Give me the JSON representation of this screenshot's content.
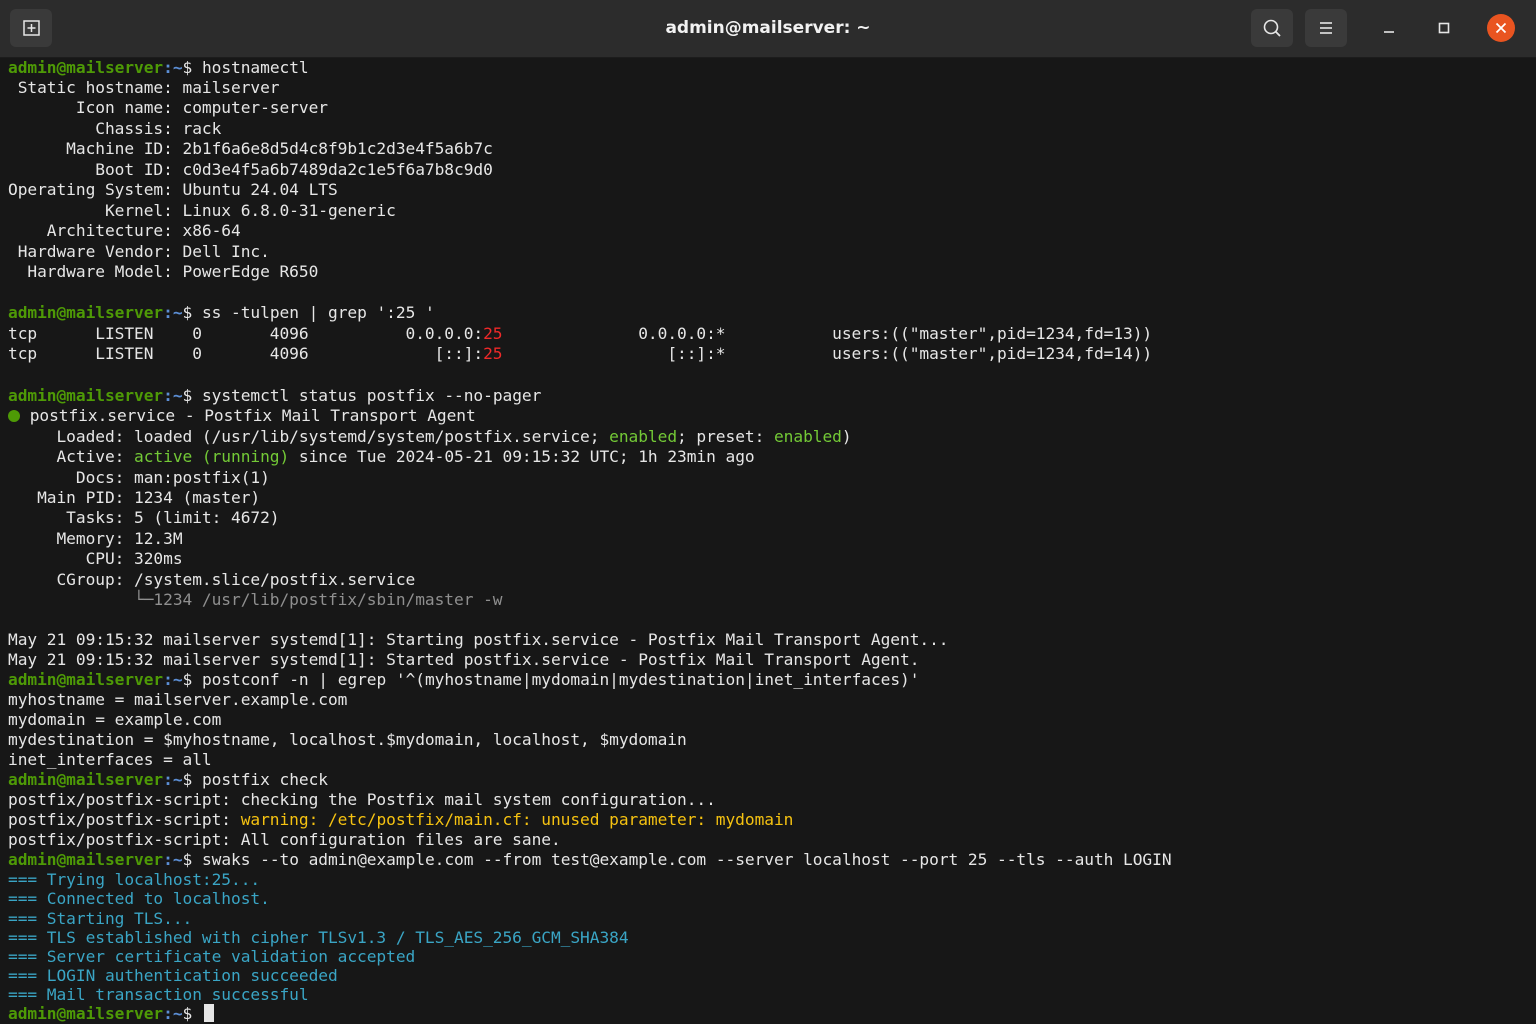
{
  "window": {
    "title": "admin@mailserver: ~",
    "icons": {
      "new_tab": "new-tab-icon",
      "search": "search-icon",
      "menu": "hamburger-menu-icon",
      "minimize": "minimize-icon",
      "maximize": "maximize-icon",
      "close": "close-icon"
    },
    "colors": {
      "close_button": "#e95420",
      "background": "#171717",
      "titlebar": "#2c2c2c"
    }
  },
  "prompt": {
    "user_host": "admin@mailserver",
    "path": ":~",
    "symbol": "$ "
  },
  "colors": {
    "prompt_user": "#4e9a06",
    "prompt_path": "#5c8fd6",
    "port_highlight": "#ef2929",
    "enabled_green": "#73c936",
    "warning_yellow": "#f5c211",
    "swaks_cyan": "#3aa5c5"
  },
  "commands": {
    "hostnamectl": "hostnamectl",
    "ss": "ss -tulpen | grep ':25 '",
    "systemctl": "systemctl status postfix --no-pager",
    "postconf": "postconf -n | egrep '^(myhostname|mydomain|mydestination|inet_interfaces)'",
    "postfix_check": "postfix check",
    "swaks": "swaks --to admin@example.com --from test@example.com --server localhost --port 25 --tls --auth LOGIN"
  },
  "hostnamectl": [
    " Static hostname: mailserver",
    "       Icon name: computer-server",
    "         Chassis: rack",
    "      Machine ID: 2b1f6a6e8d5d4c8f9b1c2d3e4f5a6b7c",
    "         Boot ID: c0d3e4f5a6b7489da2c1e5f6a7b8c9d0",
    "Operating System: Ubuntu 24.04 LTS",
    "          Kernel: Linux 6.8.0-31-generic",
    "    Architecture: x86-64",
    " Hardware Vendor: Dell Inc.",
    "  Hardware Model: PowerEdge R650"
  ],
  "ss_rows": [
    {
      "pre": "tcp      LISTEN    0       4096          0.0.0.0:",
      "port": "25",
      "post": "              0.0.0.0:*           users:((\"master\",pid=1234,fd=13))"
    },
    {
      "pre": "tcp      LISTEN    0       4096             [::]:",
      "port": "25",
      "post": "                 [::]:*           users:((\"master\",pid=1234,fd=14))"
    }
  ],
  "systemctl": {
    "unit_line": " postfix.service - Postfix Mail Transport Agent",
    "loaded_pre": "     Loaded: loaded (/usr/lib/systemd/system/postfix.service; ",
    "loaded_enabled": "enabled",
    "loaded_mid": "; preset: ",
    "loaded_preset": "enabled",
    "loaded_end": ")",
    "active_label": "     Active: ",
    "active_state": "active (running)",
    "active_rest": " since Tue 2024-05-21 09:15:32 UTC; 1h 23min ago",
    "docs": "       Docs: man:postfix(1)",
    "main_pid": "   Main PID: 1234 (master)",
    "tasks": "      Tasks: 5 (limit: 4672)",
    "memory": "     Memory: 12.3M",
    "cpu": "        CPU: 320ms",
    "cgroup": "     CGroup: /system.slice/postfix.service",
    "cgroup_child": "             └─1234 /usr/lib/postfix/sbin/master -w",
    "log1": "May 21 09:15:32 mailserver systemd[1]: Starting postfix.service - Postfix Mail Transport Agent...",
    "log2": "May 21 09:15:32 mailserver systemd[1]: Started postfix.service - Postfix Mail Transport Agent."
  },
  "postconf": [
    "myhostname = mailserver.example.com",
    "mydomain = example.com",
    "mydestination = $myhostname, localhost.$mydomain, localhost, $mydomain",
    "inet_interfaces = all"
  ],
  "postfix_check": {
    "line1": "postfix/postfix-script: checking the Postfix mail system configuration...",
    "warn_prefix": "postfix/postfix-script: ",
    "warn_text": "warning: /etc/postfix/main.cf: unused parameter: mydomain",
    "line3": "postfix/postfix-script: All configuration files are sane."
  },
  "swaks": [
    "=== Trying localhost:25...",
    "=== Connected to localhost.",
    "=== Starting TLS...",
    "=== TLS established with cipher TLSv1.3 / TLS_AES_256_GCM_SHA384",
    "=== Server certificate validation accepted",
    "=== LOGIN authentication succeeded",
    "=== Mail transaction successful"
  ]
}
